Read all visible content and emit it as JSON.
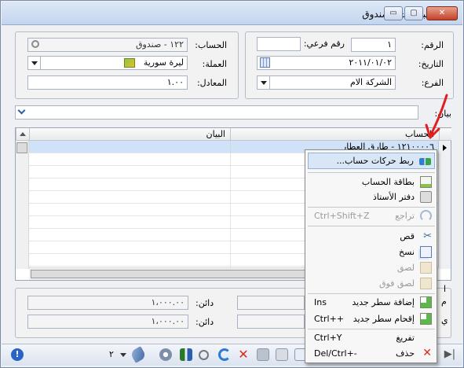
{
  "window": {
    "title": "مقبوضات الصندوق",
    "min_glyph": "▭",
    "max_glyph": "▢",
    "close_glyph": "✕"
  },
  "header": {
    "number_label": "الرقم:",
    "number_value": "١",
    "subnumber_label": "رقم فرعي:",
    "subnumber_value": "",
    "date_label": "التاريخ:",
    "date_value": "٢٠١١/٠١/٠٢",
    "branch_label": "الفرع:",
    "branch_value": "الشركة الام",
    "account_label": "الحساب:",
    "account_value": "١٢٢ - صندوق",
    "currency_label": "العملة:",
    "currency_value": "ليرة سورية",
    "rate_label": "المعادل:",
    "rate_value": "١.٠٠",
    "statement_label": "بيان:",
    "statement_value": ""
  },
  "grid": {
    "columns": [
      "الحساب",
      "البيان"
    ],
    "rows": [
      {
        "account": "١٢١٠٠٠٠٦ - طارق العطار",
        "statement": ""
      }
    ],
    "row_count": 11
  },
  "footer": {
    "credit_label_1": "دائن:",
    "credit_value_1": "١،٠٠٠.٠٠",
    "credit_label_2": "دائن:",
    "credit_value_2": "١،٠٠٠.٠٠",
    "left_letter_1": "م",
    "left_letter_2": "ي",
    "hidden_label": "ا"
  },
  "toolbar": {
    "page_number": "٢"
  },
  "context_menu": {
    "items": [
      {
        "label": "ربط حركات حساب...",
        "shortcut": "",
        "icon": "link-icon",
        "highlighted": true,
        "disabled": false
      },
      {
        "label": "بطاقة الحساب",
        "shortcut": "",
        "icon": "card-icon",
        "highlighted": false,
        "disabled": false
      },
      {
        "label": "دفتر الأستاذ",
        "shortcut": "",
        "icon": "ledger-icon",
        "highlighted": false,
        "disabled": false
      },
      {
        "label": "تراجع",
        "shortcut": "Ctrl+Shift+Z",
        "icon": "undo-icon",
        "highlighted": false,
        "disabled": true
      },
      {
        "label": "قص",
        "shortcut": "",
        "icon": "cut-icon",
        "highlighted": false,
        "disabled": false
      },
      {
        "label": "نسخ",
        "shortcut": "",
        "icon": "copy-icon",
        "highlighted": false,
        "disabled": false
      },
      {
        "label": "لصق",
        "shortcut": "",
        "icon": "paste-icon",
        "highlighted": false,
        "disabled": true
      },
      {
        "label": "لصق فوق",
        "shortcut": "",
        "icon": "paste-over-icon",
        "highlighted": false,
        "disabled": true
      },
      {
        "label": "إضافة سطر جديد",
        "shortcut": "Ins",
        "icon": "add-row-icon",
        "highlighted": false,
        "disabled": false
      },
      {
        "label": "إقحام سطر جديد",
        "shortcut": "Ctrl++",
        "icon": "insert-row-icon",
        "highlighted": false,
        "disabled": false
      },
      {
        "label": "تفريغ",
        "shortcut": "Ctrl+Y",
        "icon": "clear-icon",
        "highlighted": false,
        "disabled": false
      },
      {
        "label": "حذف",
        "shortcut": "Del/Ctrl+-",
        "icon": "delete-icon",
        "highlighted": false,
        "disabled": false
      }
    ]
  },
  "colors": {
    "accent": "#cfe2f7",
    "annotation_arrow": "#e02020"
  }
}
